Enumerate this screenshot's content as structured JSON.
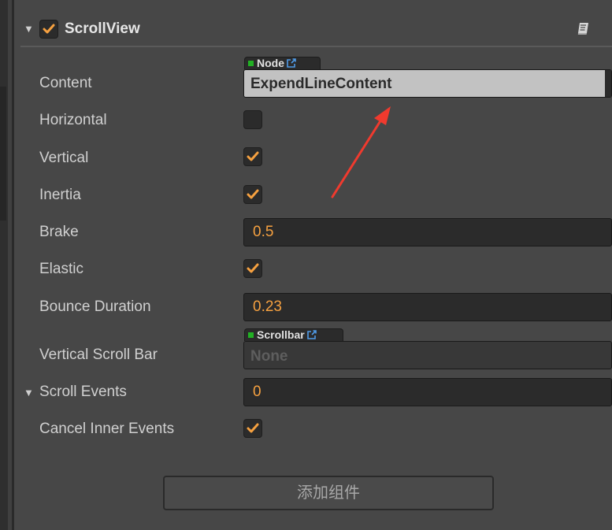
{
  "colors": {
    "panel_bg": "#474747",
    "accent_check": "#f6a140",
    "value_orange": "#f6a140",
    "node_green": "#22b024",
    "annotation_red": "#f03a2e"
  },
  "component": {
    "title": "ScrollView",
    "enabled": true
  },
  "properties": {
    "content": {
      "label": "Content",
      "type_tag": "Node",
      "value": "ExpendLineContent"
    },
    "horizontal": {
      "label": "Horizontal",
      "checked": false
    },
    "vertical": {
      "label": "Vertical",
      "checked": true
    },
    "inertia": {
      "label": "Inertia",
      "checked": true
    },
    "brake": {
      "label": "Brake",
      "value": "0.5"
    },
    "elastic": {
      "label": "Elastic",
      "checked": true
    },
    "bounce_duration": {
      "label": "Bounce Duration",
      "value": "0.23"
    },
    "vertical_scroll_bar": {
      "label": "Vertical Scroll Bar",
      "type_tag": "Scrollbar",
      "value": "None"
    },
    "scroll_events": {
      "label": "Scroll Events",
      "value": "0"
    },
    "cancel_inner_events": {
      "label": "Cancel Inner Events",
      "checked": true
    }
  },
  "add_component_button": "添加组件",
  "icons": {
    "fold": "triangle-down-icon",
    "check": "checkmark-icon",
    "help": "book-icon",
    "link": "external-link-icon"
  }
}
